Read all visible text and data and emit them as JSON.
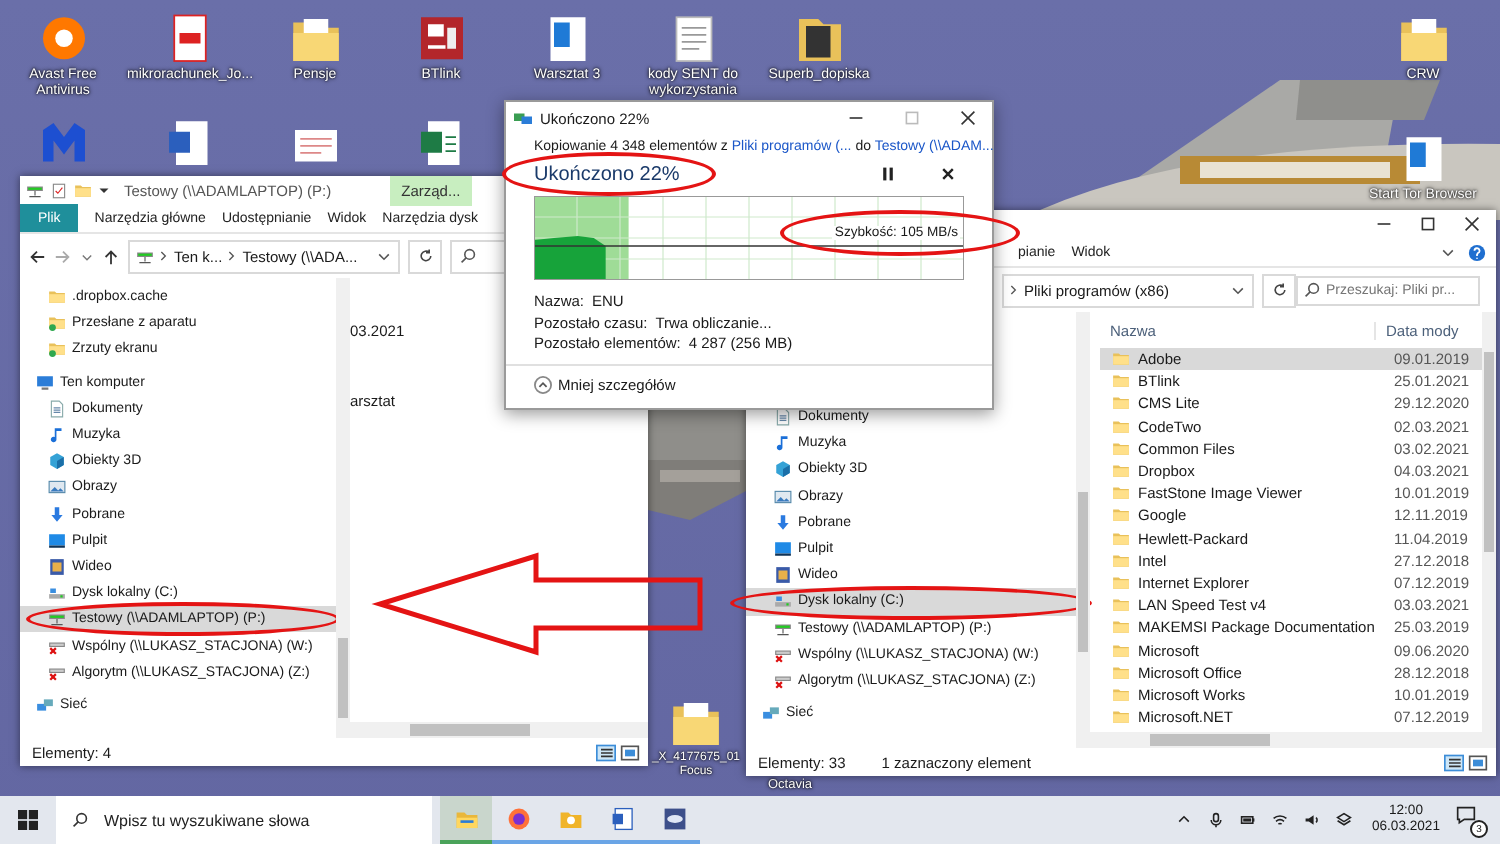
{
  "desktop": {
    "icons": [
      {
        "label": "Avast Free Antivirus",
        "kind": "avast"
      },
      {
        "label": "mikrorachunek_Jo...",
        "kind": "pdf"
      },
      {
        "label": "Pensje",
        "kind": "folder_doc"
      },
      {
        "label": "BTlink",
        "kind": "app_red"
      },
      {
        "label": "Warsztat 3",
        "kind": "doc_blue"
      },
      {
        "label": "kody SENT do wykorzystania",
        "kind": "doc_lines"
      },
      {
        "label": "Superb_dopiska",
        "kind": "folder_dark"
      }
    ],
    "icons_row2": [
      {
        "kind": "malware"
      },
      {
        "kind": "word"
      },
      {
        "kind": "doc_pink"
      },
      {
        "kind": "excel"
      }
    ],
    "right_icons": [
      {
        "label": "CRW",
        "kind": "folder_doc"
      },
      {
        "label": "Start Tor Browser",
        "kind": "doc_blue"
      }
    ],
    "bottom_icon": {
      "label": "_X_4177675_01 Focus",
      "kind": "folder_doc"
    },
    "bottom_label": "Octavia"
  },
  "left_window": {
    "title": "Testowy (\\\\ADAMLAPTOP) (P:)",
    "context_tab": "Zarząd...",
    "ribbon_tabs": [
      {
        "label": "Plik",
        "selected": true
      },
      {
        "label": "Narzędzia główne",
        "selected": false
      },
      {
        "label": "Udostępnianie",
        "selected": false
      },
      {
        "label": "Widok",
        "selected": false
      },
      {
        "label": "Narzędzia dysk",
        "selected": false
      }
    ],
    "breadcrumb": [
      "Ten k...",
      "Testowy (\\\\ADA..."
    ],
    "nav": [
      {
        "label": ".dropbox.cache",
        "kind": "folder",
        "selected": false,
        "circled": false
      },
      {
        "label": "Przesłane z aparatu",
        "kind": "folder_sync",
        "selected": false,
        "circled": false
      },
      {
        "label": "Zrzuty ekranu",
        "kind": "folder_sync",
        "selected": false,
        "circled": false
      },
      {
        "label": "Ten komputer",
        "kind": "pc",
        "selected": false,
        "circled": false
      },
      {
        "label": "Dokumenty",
        "kind": "document",
        "selected": false,
        "circled": false
      },
      {
        "label": "Muzyka",
        "kind": "music",
        "selected": false,
        "circled": false
      },
      {
        "label": "Obiekty 3D",
        "kind": "cube",
        "selected": false,
        "circled": false
      },
      {
        "label": "Obrazy",
        "kind": "images",
        "selected": false,
        "circled": false
      },
      {
        "label": "Pobrane",
        "kind": "download",
        "selected": false,
        "circled": false
      },
      {
        "label": "Pulpit",
        "kind": "desktop",
        "selected": false,
        "circled": false
      },
      {
        "label": "Wideo",
        "kind": "video",
        "selected": false,
        "circled": false
      },
      {
        "label": "Dysk lokalny (C:)",
        "kind": "drive",
        "selected": false,
        "circled": false
      },
      {
        "label": "Testowy (\\\\ADAMLAPTOP) (P:)",
        "kind": "netdrive",
        "selected": true,
        "circled": true
      },
      {
        "label": "Wspólny (\\\\LUKASZ_STACJONA) (W:)",
        "kind": "netdrive_off",
        "selected": false,
        "circled": false
      },
      {
        "label": "Algorytm (\\\\LUKASZ_STACJONA) (Z:)",
        "kind": "netdrive_off",
        "selected": false,
        "circled": false
      },
      {
        "label": "Sieć",
        "kind": "network",
        "selected": false,
        "circled": false
      }
    ],
    "content": [
      "03.2021",
      "arsztat"
    ],
    "status": [
      "Elementy: 4"
    ]
  },
  "copy_dialog": {
    "title": "Ukończono 22%",
    "description": {
      "prefix": "Kopiowanie 4 348 elementów z",
      "source": "Pliki programów (...",
      "middle": "do",
      "target": "Testowy (\\\\ADAM..."
    },
    "heading": "Ukończono 22%",
    "heading_circled": true,
    "progress": {
      "level": 0.22
    },
    "speed": "Szybkość: 105 MB/s",
    "speed_circled": true,
    "details": [
      {
        "label": "Nazwa:",
        "value": "ENU"
      },
      {
        "label": "Pozostało czasu:",
        "value": "Trwa obliczanie..."
      },
      {
        "label": "Pozostało elementów:",
        "value": "4 287 (256 MB)"
      }
    ],
    "toggle": "Mniej szczegółów"
  },
  "right_window": {
    "ribbon_tabs": [
      {
        "label": "pianie",
        "selected": false
      },
      {
        "label": "Widok",
        "selected": false
      }
    ],
    "breadcrumb": [
      "Pliki programów (x86)"
    ],
    "search": {
      "placeholder": "Przeszukaj: Pliki pr..."
    },
    "nav": [
      {
        "label": "Dokumenty",
        "kind": "document",
        "selected": false,
        "circled": false
      },
      {
        "label": "Muzyka",
        "kind": "music",
        "selected": false,
        "circled": false
      },
      {
        "label": "Obiekty 3D",
        "kind": "cube",
        "selected": false,
        "circled": false
      },
      {
        "label": "Obrazy",
        "kind": "images",
        "selected": false,
        "circled": false
      },
      {
        "label": "Pobrane",
        "kind": "download",
        "selected": false,
        "circled": false
      },
      {
        "label": "Pulpit",
        "kind": "desktop",
        "selected": false,
        "circled": false
      },
      {
        "label": "Wideo",
        "kind": "video",
        "selected": false,
        "circled": false
      },
      {
        "label": "Dysk lokalny (C:)",
        "kind": "drive",
        "selected": true,
        "circled": true
      },
      {
        "label": "Testowy (\\\\ADAMLAPTOP) (P:)",
        "kind": "netdrive",
        "selected": false,
        "circled": false
      },
      {
        "label": "Wspólny (\\\\LUKASZ_STACJONA) (W:)",
        "kind": "netdrive_off",
        "selected": false,
        "circled": false
      },
      {
        "label": "Algorytm (\\\\LUKASZ_STACJONA) (Z:)",
        "kind": "netdrive_off",
        "selected": false,
        "circled": false
      },
      {
        "label": "Sieć",
        "kind": "network",
        "selected": false,
        "circled": false
      }
    ],
    "columns": [
      "Nazwa",
      "Data mody"
    ],
    "rows": [
      {
        "name": "Adobe",
        "date": "09.01.2019",
        "selected": true
      },
      {
        "name": "BTlink",
        "date": "25.01.2021",
        "selected": false
      },
      {
        "name": "CMS Lite",
        "date": "29.12.2020",
        "selected": false
      },
      {
        "name": "CodeTwo",
        "date": "02.03.2021",
        "selected": false
      },
      {
        "name": "Common Files",
        "date": "03.02.2021",
        "selected": false
      },
      {
        "name": "Dropbox",
        "date": "04.03.2021",
        "selected": false
      },
      {
        "name": "FastStone Image Viewer",
        "date": "10.01.2019",
        "selected": false
      },
      {
        "name": "Google",
        "date": "12.11.2019",
        "selected": false
      },
      {
        "name": "Hewlett-Packard",
        "date": "11.04.2019",
        "selected": false
      },
      {
        "name": "Intel",
        "date": "27.12.2018",
        "selected": false
      },
      {
        "name": "Internet Explorer",
        "date": "07.12.2019",
        "selected": false
      },
      {
        "name": "LAN Speed Test v4",
        "date": "03.03.2021",
        "selected": false
      },
      {
        "name": "MAKEMSI Package Documentation",
        "date": "25.03.2019",
        "selected": false
      },
      {
        "name": "Microsoft",
        "date": "09.06.2020",
        "selected": false
      },
      {
        "name": "Microsoft Office",
        "date": "28.12.2018",
        "selected": false
      },
      {
        "name": "Microsoft Works",
        "date": "10.01.2019",
        "selected": false
      },
      {
        "name": "Microsoft.NET",
        "date": "07.12.2019",
        "selected": false
      }
    ],
    "status": [
      "Elementy: 33",
      "1 zaznaczony element"
    ]
  },
  "annotation_arrow": true,
  "taskbar": {
    "search": {
      "placeholder": "Wpisz tu wyszukiwane słowa"
    },
    "apps": [
      {
        "kind": "explorer",
        "selected": true
      },
      {
        "kind": "firefox",
        "selected": false
      },
      {
        "kind": "folder_star",
        "selected": false
      },
      {
        "kind": "word",
        "selected": false
      },
      {
        "kind": "disk_app",
        "selected": false
      }
    ],
    "time": "12:00",
    "date": "06.03.2021",
    "notifications": "3"
  }
}
